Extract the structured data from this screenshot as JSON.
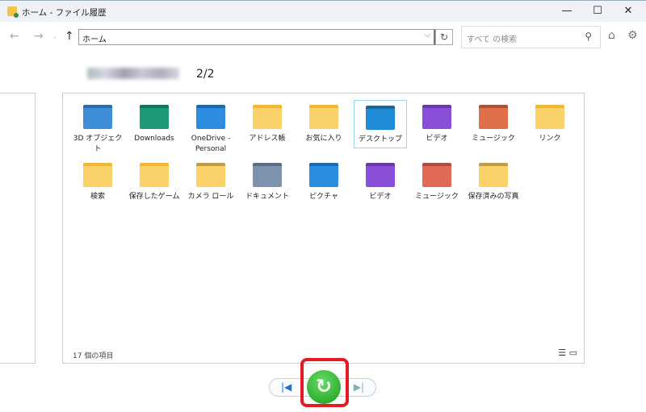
{
  "window": {
    "title": "ホーム - ファイル履歴",
    "minimize": "—",
    "maximize": "☐",
    "close": "✕"
  },
  "nav": {
    "back": "←",
    "forward": "→",
    "recent": "ˎ",
    "up": "↑",
    "address": "ホーム",
    "dropdown": "⌵",
    "refresh": "↻"
  },
  "search": {
    "placeholder": "すべて の検索",
    "icon": "⚲"
  },
  "tools": {
    "home": "⌂",
    "settings": "⚙"
  },
  "pager": "2/2",
  "items": [
    {
      "label": "3D オブジェクト",
      "icon": "3d-objects-folder",
      "color": "#3f8fd8"
    },
    {
      "label": "Downloads",
      "icon": "downloads-folder",
      "color": "#1e9a78"
    },
    {
      "label": "OneDrive - Personal",
      "icon": "onedrive-folder",
      "color": "#2d8be0"
    },
    {
      "label": "アドレス帳",
      "icon": "folder",
      "color": "#fbd26a"
    },
    {
      "label": "お気に入り",
      "icon": "folder",
      "color": "#fbd26a"
    },
    {
      "label": "デスクトップ",
      "icon": "desktop-folder",
      "color": "#1f8ad6"
    },
    {
      "label": "ビデオ",
      "icon": "videos-folder",
      "color": "#8a4fd8"
    },
    {
      "label": "ミュージック",
      "icon": "music-folder",
      "color": "#e0704a"
    },
    {
      "label": "リンク",
      "icon": "folder",
      "color": "#fbd26a"
    },
    {
      "label": "検索",
      "icon": "folder",
      "color": "#fbd26a"
    },
    {
      "label": "保存したゲーム",
      "icon": "folder",
      "color": "#fbd26a"
    },
    {
      "label": "カメラ ロール",
      "icon": "library-folder",
      "color": "#fbd26a"
    },
    {
      "label": "ドキュメント",
      "icon": "documents-library",
      "color": "#7d93ad"
    },
    {
      "label": "ピクチャ",
      "icon": "pictures-library",
      "color": "#2a8ee0"
    },
    {
      "label": "ビデオ",
      "icon": "videos-library",
      "color": "#8a4fd8"
    },
    {
      "label": "ミュージック",
      "icon": "music-library",
      "color": "#e06a55"
    },
    {
      "label": "保存済みの写真",
      "icon": "library-folder",
      "color": "#fbd26a"
    }
  ],
  "status": "17 個の項目",
  "views": {
    "details": "☰",
    "tiles": "▭"
  },
  "controls": {
    "previous": "|◀",
    "restore": "↻",
    "next": "▶|"
  }
}
